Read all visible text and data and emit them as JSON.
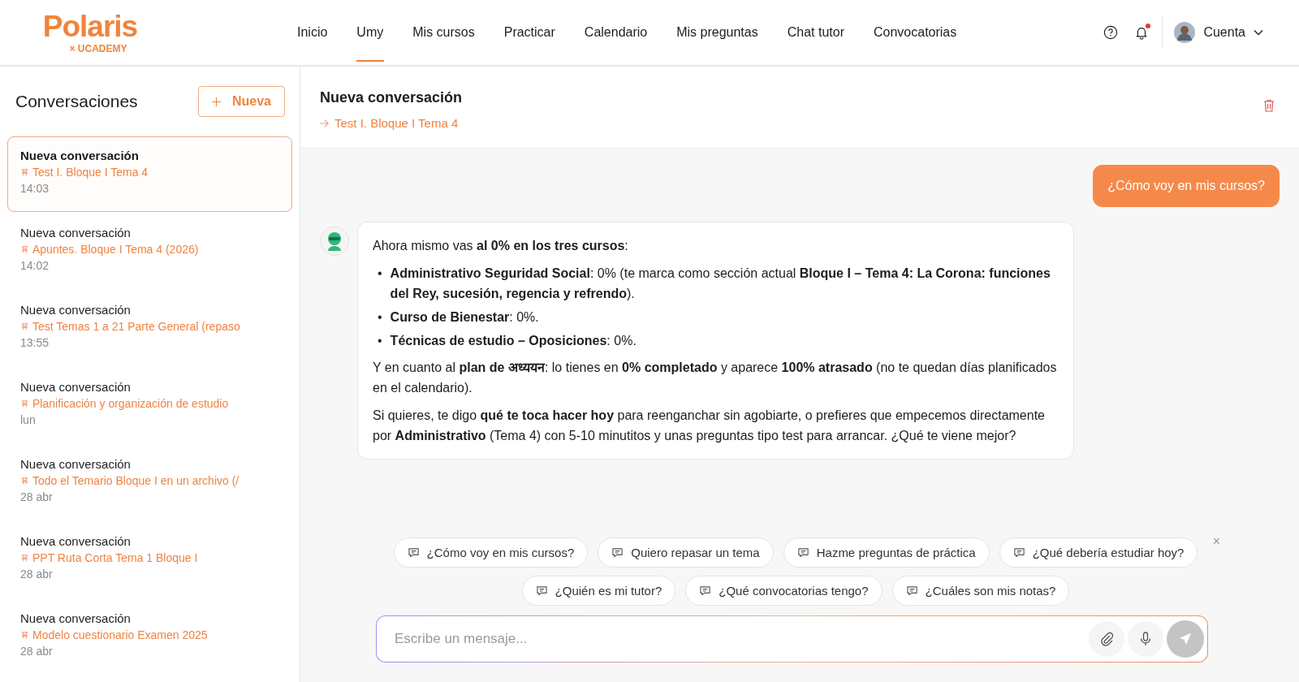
{
  "logo": {
    "name": "Polaris",
    "partner": "× UCADEMY"
  },
  "nav": [
    {
      "label": "Inicio",
      "selected": false
    },
    {
      "label": "Umy",
      "selected": true
    },
    {
      "label": "Mis cursos",
      "selected": false
    },
    {
      "label": "Practicar",
      "selected": false
    },
    {
      "label": "Calendario",
      "selected": false
    },
    {
      "label": "Mis preguntas",
      "selected": false
    },
    {
      "label": "Chat tutor",
      "selected": false
    },
    {
      "label": "Convocatorias",
      "selected": false
    }
  ],
  "account": {
    "label": "Cuenta",
    "notifications_unread": true
  },
  "sidebar": {
    "title": "Conversaciones",
    "new_button": "Nueva",
    "conversations": [
      {
        "title": "Nueva conversación",
        "source": "Test I. Bloque I Tema 4",
        "time": "14:03",
        "selected": true
      },
      {
        "title": "Nueva conversación",
        "source": "Apuntes. Bloque I Tema 4 (2026)",
        "time": "14:02",
        "selected": false
      },
      {
        "title": "Nueva conversación",
        "source": "Test Temas 1 a 21 Parte General (repaso",
        "time": "13:55",
        "selected": false
      },
      {
        "title": "Nueva conversación",
        "source": "Planificación y organización de estudio",
        "time": "lun",
        "selected": false
      },
      {
        "title": "Nueva conversación",
        "source": "Todo el Temario Bloque I en un archivo (/",
        "time": "28 abr",
        "selected": false
      },
      {
        "title": "Nueva conversación",
        "source": "PPT Ruta Corta Tema 1 Bloque I",
        "time": "28 abr",
        "selected": false
      },
      {
        "title": "Nueva conversación",
        "source": "Modelo cuestionario Examen 2025",
        "time": "28 abr",
        "selected": false
      }
    ]
  },
  "chat": {
    "title": "Nueva conversación",
    "source": "Test I. Bloque I Tema 4",
    "messages": [
      {
        "kind": "user",
        "text": "¿Cómo voy en mis cursos?"
      },
      {
        "kind": "assistant",
        "blocks": [
          {
            "kind": "paragraph",
            "text": "Ahora mismo vas **al 0% en los tres cursos**:"
          },
          {
            "kind": "list",
            "items": [
              {
                "marker": "•",
                "text": "**Administrativo Seguridad Social**: 0% (te marca como sección actual **Bloque I – Tema 4: La Corona: funciones del Rey, sucesión, regencia y refrendo**)."
              },
              {
                "marker": "•",
                "text": "**Curso de Bienestar**: 0%."
              },
              {
                "marker": "•",
                "text": "**Técnicas de estudio – Oposiciones**: 0%."
              }
            ]
          },
          {
            "kind": "paragraph",
            "text": "Y en cuanto al **plan de अध्ययन**: lo tienes en **0% completado** y aparece **100% atrasado** (no te quedan días planificados en el calendario)."
          },
          {
            "kind": "paragraph",
            "text": "Si quieres, te digo **qué te toca hacer hoy** para reenganchar sin agobiarte, o prefieres que empecemos directamente por **Administrativo** (Tema 4) con 5-10 minutitos y unas preguntas tipo test para arrancar. ¿Qué te viene mejor?"
          }
        ]
      }
    ],
    "suggestions": [
      "¿Cómo voy en mis cursos?",
      "Quiero repasar un tema",
      "Hazme preguntas de práctica",
      "¿Qué debería estudiar hoy?",
      "¿Quién es mi tutor?",
      "¿Qué convocatorias tengo?",
      "¿Cuáles son mis notas?"
    ],
    "dismiss": "×",
    "input": {
      "placeholder": "Escribe un mensaje..."
    }
  }
}
